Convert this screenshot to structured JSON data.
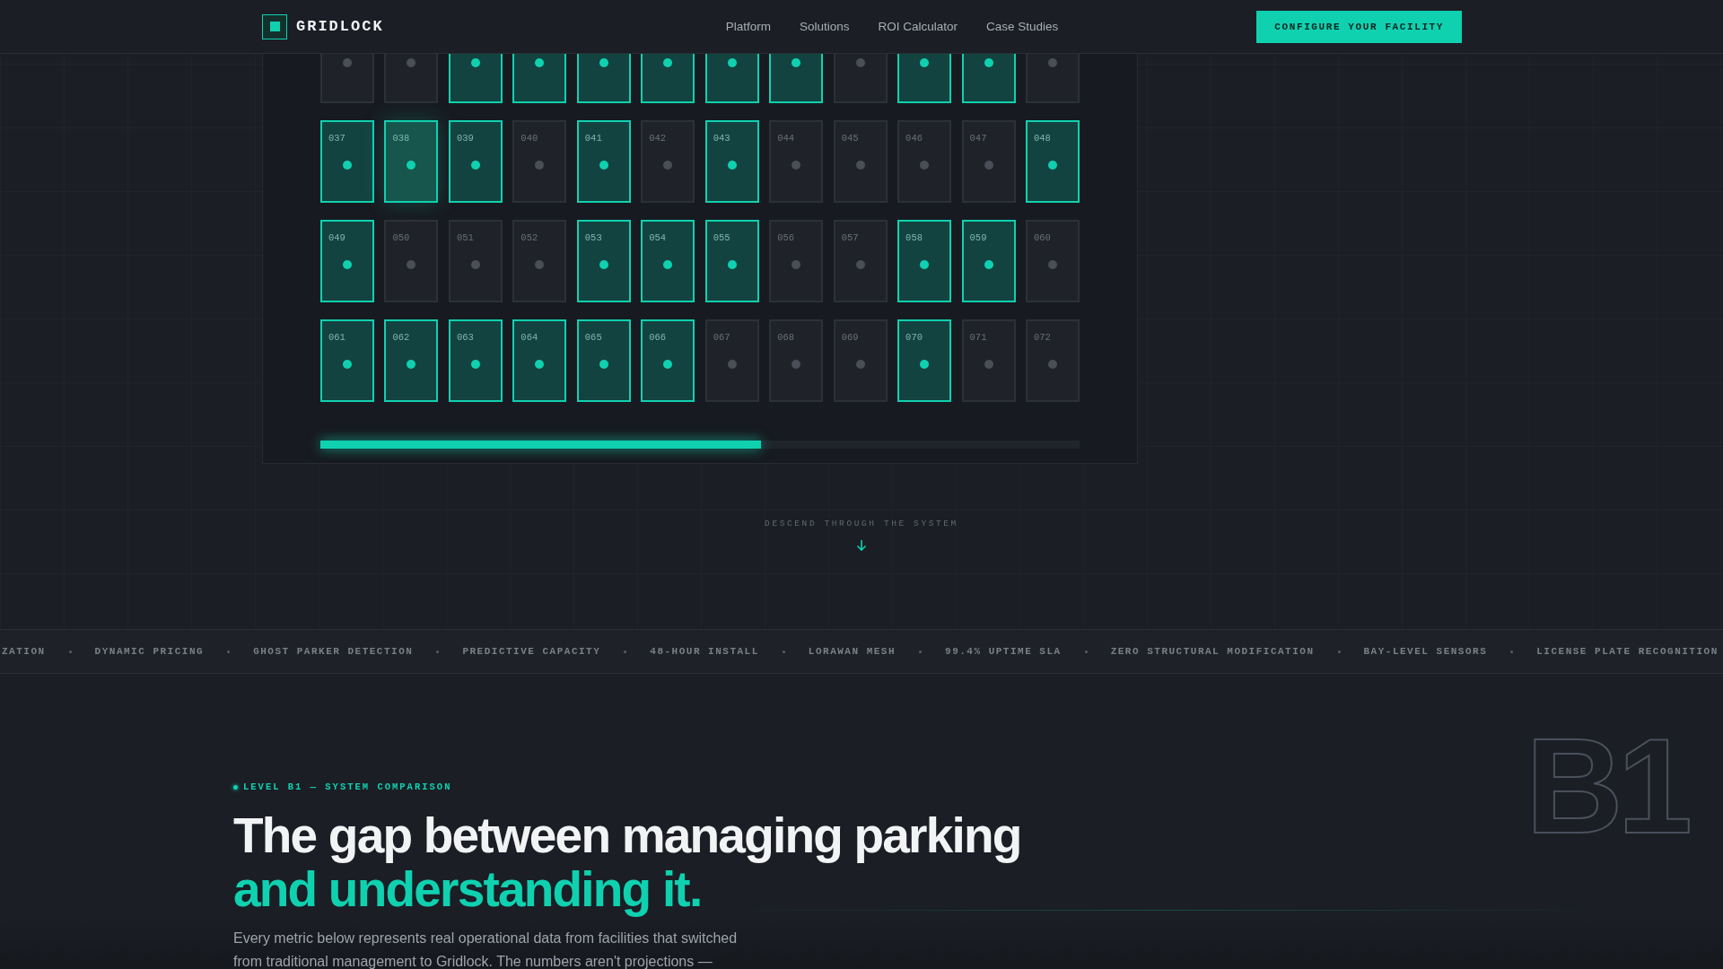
{
  "nav": {
    "brand": "GRIDLOCK",
    "links": [
      "Platform",
      "Solutions",
      "ROI Calculator",
      "Case Studies"
    ],
    "cta": "CONFIGURE YOUR FACILITY"
  },
  "bay_rows": [
    {
      "partial": true,
      "bays": [
        {
          "occupied": false
        },
        {
          "occupied": false
        },
        {
          "occupied": true
        },
        {
          "occupied": true
        },
        {
          "occupied": true
        },
        {
          "occupied": true
        },
        {
          "occupied": true
        },
        {
          "occupied": true
        },
        {
          "occupied": false
        },
        {
          "occupied": true
        },
        {
          "occupied": true
        },
        {
          "occupied": false
        }
      ]
    },
    {
      "partial": false,
      "bays": [
        {
          "label": "037",
          "occupied": true,
          "selected": false
        },
        {
          "label": "038",
          "occupied": true,
          "selected": true
        },
        {
          "label": "039",
          "occupied": true,
          "selected": false
        },
        {
          "label": "040",
          "occupied": false,
          "selected": false
        },
        {
          "label": "041",
          "occupied": true,
          "selected": false
        },
        {
          "label": "042",
          "occupied": false,
          "selected": false
        },
        {
          "label": "043",
          "occupied": true,
          "selected": false
        },
        {
          "label": "044",
          "occupied": false,
          "selected": false
        },
        {
          "label": "045",
          "occupied": false,
          "selected": false
        },
        {
          "label": "046",
          "occupied": false,
          "selected": false
        },
        {
          "label": "047",
          "occupied": false,
          "selected": false
        },
        {
          "label": "048",
          "occupied": true,
          "selected": false
        }
      ]
    },
    {
      "partial": false,
      "bays": [
        {
          "label": "049",
          "occupied": true,
          "selected": false
        },
        {
          "label": "050",
          "occupied": false,
          "selected": false
        },
        {
          "label": "051",
          "occupied": false,
          "selected": false
        },
        {
          "label": "052",
          "occupied": false,
          "selected": false
        },
        {
          "label": "053",
          "occupied": true,
          "selected": false
        },
        {
          "label": "054",
          "occupied": true,
          "selected": false
        },
        {
          "label": "055",
          "occupied": true,
          "selected": false
        },
        {
          "label": "056",
          "occupied": false,
          "selected": false
        },
        {
          "label": "057",
          "occupied": false,
          "selected": false
        },
        {
          "label": "058",
          "occupied": true,
          "selected": false
        },
        {
          "label": "059",
          "occupied": true,
          "selected": false
        },
        {
          "label": "060",
          "occupied": false,
          "selected": false
        }
      ]
    },
    {
      "partial": false,
      "bays": [
        {
          "label": "061",
          "occupied": true,
          "selected": false
        },
        {
          "label": "062",
          "occupied": true,
          "selected": false
        },
        {
          "label": "063",
          "occupied": true,
          "selected": false
        },
        {
          "label": "064",
          "occupied": true,
          "selected": false
        },
        {
          "label": "065",
          "occupied": true,
          "selected": false
        },
        {
          "label": "066",
          "occupied": true,
          "selected": false
        },
        {
          "label": "067",
          "occupied": false,
          "selected": false
        },
        {
          "label": "068",
          "occupied": false,
          "selected": false
        },
        {
          "label": "069",
          "occupied": false,
          "selected": false
        },
        {
          "label": "070",
          "occupied": true,
          "selected": false
        },
        {
          "label": "071",
          "occupied": false,
          "selected": false
        },
        {
          "label": "072",
          "occupied": false,
          "selected": false
        }
      ]
    }
  ],
  "occupancy": {
    "level": 0.58
  },
  "descend": "DESCEND THROUGH THE SYSTEM",
  "ticker": [
    "ZATION",
    "DYNAMIC PRICING",
    "GHOST PARKER DETECTION",
    "PREDICTIVE CAPACITY",
    "48-HOUR INSTALL",
    "LORAWAN MESH",
    "99.4% UPTIME SLA",
    "ZERO STRUCTURAL MODIFICATION",
    "BAY-LEVEL SENSORS",
    "LICENSE PLATE RECOGNITION"
  ],
  "section": {
    "eyebrow": "LEVEL B1 — SYSTEM COMPARISON",
    "heading": "The gap between managing parking",
    "heading_accent": "and understanding it.",
    "body": "Every metric below represents real operational data from facilities that switched from traditional management to Gridlock. The numbers aren't projections —",
    "level_mark": "B1"
  }
}
